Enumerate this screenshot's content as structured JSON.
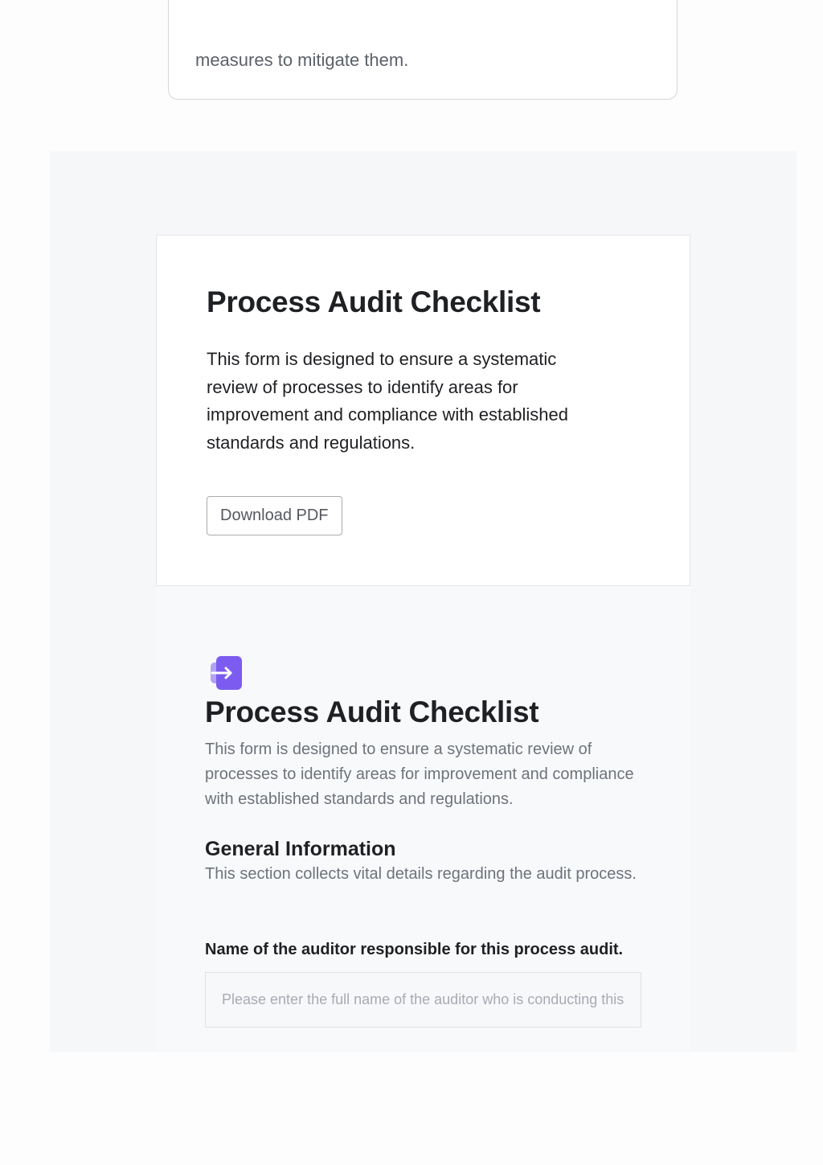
{
  "top_card": {
    "text": "measures to mitigate them."
  },
  "header": {
    "title": "Process Audit Checklist",
    "description": "This form is designed to ensure a systematic review of processes to identify areas for improvement and compliance with established standards and regulations.",
    "download_label": "Download PDF"
  },
  "form": {
    "icon": "arrow-right-icon",
    "accent_color": "#7c5cf0",
    "title": "Process Audit Checklist",
    "description": "This form is designed to ensure a systematic review of processes to identify areas for improvement and compliance with established standards and regulations.",
    "section": {
      "title": "General Information",
      "description": "This section collects vital details regarding the audit process."
    },
    "fields": [
      {
        "label": "Name of the auditor responsible for this process audit.",
        "value": "",
        "placeholder": "Please enter the full name of the auditor who is conducting this audit."
      }
    ]
  }
}
